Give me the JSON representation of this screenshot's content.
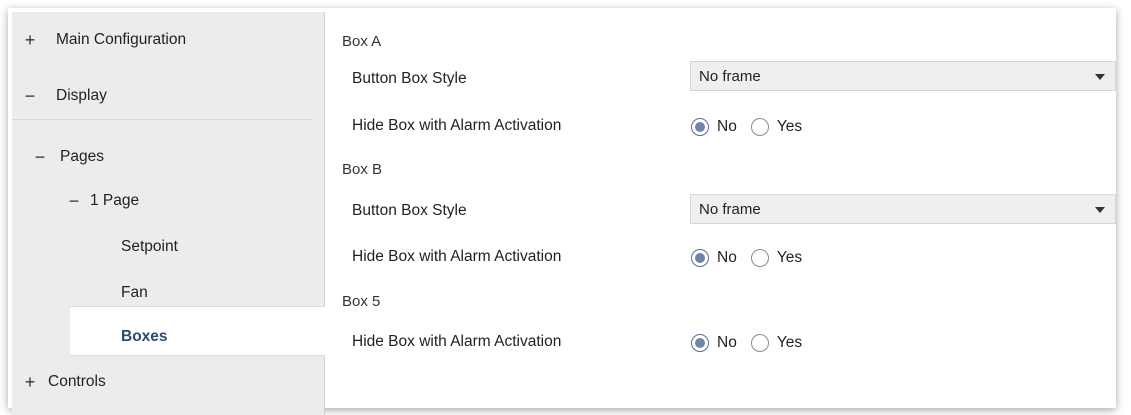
{
  "sidebar": {
    "items": [
      {
        "sign": "+",
        "label": "Main Configuration"
      },
      {
        "sign": "−",
        "label": "Display"
      },
      {
        "sign": "−",
        "label": "Pages"
      },
      {
        "sign": "−",
        "label": "1 Page"
      },
      {
        "sign": "",
        "label": "Setpoint"
      },
      {
        "sign": "",
        "label": "Fan"
      },
      {
        "sign": "",
        "label": "Boxes"
      },
      {
        "sign": "+",
        "label": "Controls"
      }
    ]
  },
  "main": {
    "box_a": {
      "title": "Box A",
      "style_label": "Button Box Style",
      "style_value": "No frame",
      "hide_label": "Hide Box with Alarm Activation",
      "opt_no": "No",
      "opt_yes": "Yes"
    },
    "box_b": {
      "title": "Box B",
      "style_label": "Button Box Style",
      "style_value": "No frame",
      "hide_label": "Hide Box with Alarm Activation",
      "opt_no": "No",
      "opt_yes": "Yes"
    },
    "box_5": {
      "title": "Box 5",
      "hide_label": "Hide Box with Alarm Activation",
      "opt_no": "No",
      "opt_yes": "Yes"
    }
  }
}
